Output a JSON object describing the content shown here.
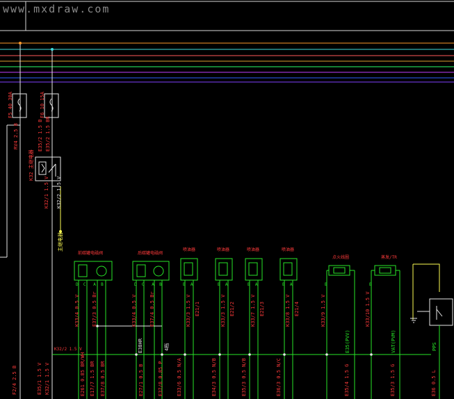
{
  "watermark": "www.mxdraw.com",
  "colors": {
    "background": "#000000",
    "wire_red": "#ff3b3b",
    "wire_green": "#27e627",
    "wire_white": "#e8e8e8",
    "wire_yellow": "#ffff55",
    "bus_orange": "#ff9a2a",
    "bus_cyan": "#3fe0e0"
  },
  "fuses": {
    "left_vertical_label": "F5 40 30A",
    "right_vertical_label": "F6 10 15A",
    "left_wire": "RV4 2.5 B",
    "right_wire": "E35/2 1.5 B",
    "right_wire_2": "E35/2 1.5 BR"
  },
  "relay": {
    "label_top": "K32 主继电器",
    "wire_a": "K32/1 1.5 V",
    "wire_b": "K32/2 1.5 V",
    "wire_c": "K32/2 1.5 V",
    "note": "主继电器"
  },
  "components": [
    {
      "title": "前碳罐电磁阀",
      "pins": [
        "D",
        "C",
        "A",
        "B"
      ],
      "wire1": "K33/4 0.5 V",
      "wire2": "E37/3 0.5 Br"
    },
    {
      "title": "后碳罐电磁阀",
      "pins": [
        "D",
        "C",
        "A",
        "B"
      ],
      "wire1": "K33/4 0.5 V",
      "wire2": "E37/4 0.5 Br"
    },
    {
      "title": "喷油器",
      "pins": [
        "B",
        "A"
      ],
      "wire1": "K33/3 1.5 V",
      "wire2": "E21/1"
    },
    {
      "title": "喷油器",
      "pins": [
        "B",
        "A"
      ],
      "wire1": "K33/3 1.5 V",
      "wire2": "E21/2"
    },
    {
      "title": "喷油器",
      "pins": [
        "B",
        "A"
      ],
      "wire1": "K33/7 1.5 V",
      "wire2": "E21/3"
    },
    {
      "title": "喷油器",
      "pins": [
        "B",
        "A"
      ],
      "wire1": "K33/8 1.5 V",
      "wire2": "E21/4"
    },
    {
      "title": "点火线圈",
      "pins": [
        "B"
      ],
      "wire1": "K33/9 1.5 V",
      "wire2": ""
    },
    {
      "title": "点火线圈",
      "pins": [
        "B"
      ],
      "wire1": "K33/10 1.5 V",
      "wire2": ""
    }
  ],
  "bottom_labels": [
    "E261 0.85 BR/WH",
    "E17/7 1.5 BR",
    "E37/8 0.5 BR",
    "E27/1 0.5 B",
    "E37/8 0.85 P",
    "E33/6 0.5 N/A",
    "E34/3 0.5 N/B",
    "E35/3 0.5 N/B",
    "E36/3 0.5 N/C",
    "E35/4 1.5 G",
    "E35/3 1.5 G",
    "E36 0.5 L"
  ],
  "left_bottom_labels": [
    "F2/4 2.5 B",
    "E35/1 1.5 V",
    "K32/1 1.5 V"
  ],
  "mid_labels": {
    "k32": "K32/2 1.5 V",
    "bhr": "E38HR",
    "g4": "4档",
    "right_a": "E35(PVV)",
    "right_b": "VAT(PVM)",
    "right_c": "PPS"
  },
  "right_switch": {
    "title": "蒸发/TR"
  }
}
